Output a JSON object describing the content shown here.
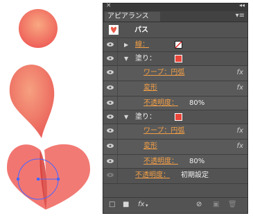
{
  "panel": {
    "tab_title": "アピアランス",
    "close_icon": "close-icon",
    "collapse_icon": "double-arrow-icon",
    "menu_icon": "panel-menu-icon"
  },
  "header": {
    "title": "パス",
    "thumb_color": "#ea5a47"
  },
  "rows": {
    "stroke": {
      "label": "線："
    },
    "fill1": {
      "label": "塗り：",
      "swatch": "#e8463a"
    },
    "fill1_warp": {
      "label": "ワープ：円弧",
      "fx": "fx"
    },
    "fill1_transform": {
      "label": "変形",
      "fx": "fx"
    },
    "fill1_opacity": {
      "label": "不透明度：",
      "value": "80%"
    },
    "fill2": {
      "label": "塗り：",
      "swatch": "#e8463a"
    },
    "fill2_warp": {
      "label": "ワープ：円弧",
      "fx": "fx"
    },
    "fill2_transform": {
      "label": "変形",
      "fx": "fx"
    },
    "fill2_opacity": {
      "label": "不透明度：",
      "value": "80%"
    },
    "opacity": {
      "label": "不透明度：",
      "value": "初期設定"
    }
  },
  "bottom": {
    "fx_label": "fx"
  },
  "colors": {
    "accent_orange": "#f5a046",
    "panel_bg": "#535353",
    "shape_red": "#e8463a"
  }
}
